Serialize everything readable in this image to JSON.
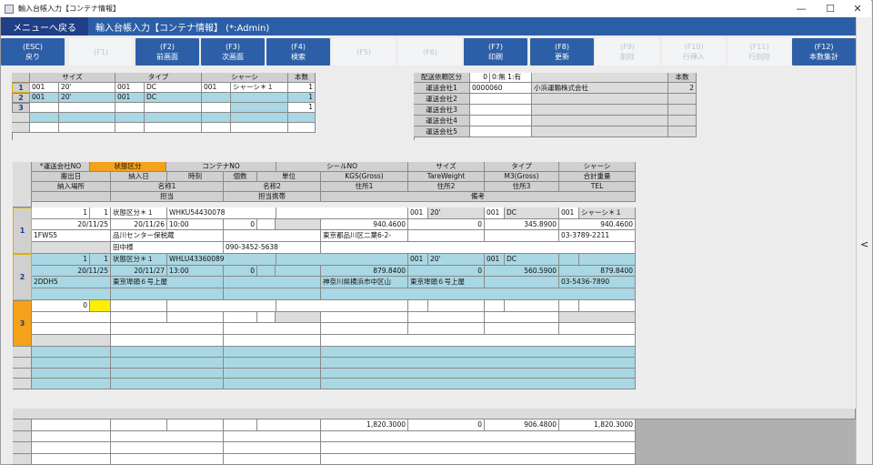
{
  "window": {
    "title": "輸入台帳入力【コンテナ情報】",
    "min": "—",
    "max": "☐",
    "close": "✕"
  },
  "header": {
    "back_label": "メニューへ戻る",
    "form_title": "輸入台帳入力【コンテナ情報】 (*:Admin)"
  },
  "fkeys": [
    {
      "key": "(ESC)",
      "label": "戻り",
      "enabled": true
    },
    {
      "key": "(F1)",
      "label": "",
      "enabled": false
    },
    {
      "key": "(F2)",
      "label": "前画面",
      "enabled": true
    },
    {
      "key": "(F3)",
      "label": "次画面",
      "enabled": true
    },
    {
      "key": "(F4)",
      "label": "検索",
      "enabled": true
    },
    {
      "key": "(F5)",
      "label": "",
      "enabled": false
    },
    {
      "key": "(F6)",
      "label": "",
      "enabled": false
    },
    {
      "key": "(F7)",
      "label": "印刷",
      "enabled": true
    },
    {
      "key": "(F8)",
      "label": "更新",
      "enabled": true
    },
    {
      "key": "(F9)",
      "label": "削除",
      "enabled": false
    },
    {
      "key": "(F10)",
      "label": "行挿入",
      "enabled": false
    },
    {
      "key": "(F11)",
      "label": "行削除",
      "enabled": false
    },
    {
      "key": "(F12)",
      "label": "本数集計",
      "enabled": true
    }
  ],
  "size_table": {
    "headers": [
      "サイズ",
      "タイプ",
      "シャーシ",
      "本数"
    ],
    "rows": [
      {
        "no": "1",
        "size_code": "001",
        "size": "20'",
        "type_code": "001",
        "type": "DC",
        "chassis_code": "001",
        "chassis": "シャーシ＊１",
        "count": "1"
      },
      {
        "no": "2",
        "size_code": "001",
        "size": "20'",
        "type_code": "001",
        "type": "DC",
        "chassis_code": "",
        "chassis": "",
        "count": "1"
      },
      {
        "no": "3",
        "size_code": "",
        "size": "",
        "type_code": "",
        "type": "",
        "chassis_code": "",
        "chassis": "",
        "count": "1"
      }
    ]
  },
  "delivery": {
    "request_label": "配送依頼区分",
    "request_value": "0",
    "request_options": "0:無 1:有",
    "count_header": "本数",
    "carriers": [
      {
        "label": "運送会社1",
        "code": "0000060",
        "name": "小浜運輸株式会社",
        "count": "2"
      },
      {
        "label": "運送会社2",
        "code": "",
        "name": "",
        "count": ""
      },
      {
        "label": "運送会社3",
        "code": "",
        "name": "",
        "count": ""
      },
      {
        "label": "運送会社4",
        "code": "",
        "name": "",
        "count": ""
      },
      {
        "label": "運送会社5",
        "code": "",
        "name": "",
        "count": ""
      }
    ]
  },
  "grid": {
    "h1": [
      "*運送会社NO",
      "状態区分",
      "コンテナNO",
      "シールNO",
      "サイズ",
      "タイプ",
      "シャーシ"
    ],
    "h2": [
      "搬出日",
      "納入日",
      "時刻",
      "個数",
      "単位",
      "KGS(Gross)",
      "TareWeight",
      "M3(Gross)",
      "合計重量"
    ],
    "h3": [
      "納入場所",
      "名称1",
      "名称2",
      "住所1",
      "住所2",
      "住所3",
      "TEL"
    ],
    "h4": [
      "担当",
      "担当携帯",
      "備考"
    ],
    "rows": [
      {
        "no": "1",
        "carrier": "1",
        "status_code": "1",
        "status": "状態区分＊１",
        "container": "WHKU54430078",
        "size_code": "001",
        "size": "20'",
        "type_code": "001",
        "type": "DC",
        "chassis_code": "001",
        "chassis": "シャーシ＊１",
        "out_date": "20/11/25",
        "in_date": "20/11/26",
        "time": "10:00",
        "qty": "0",
        "kgs": "940.4600",
        "tare": "0",
        "m3": "345.8900",
        "total": "940.4600",
        "place": "1FWS5",
        "name1": "品川センター保税蔵",
        "addr1": "東京都品川区二葉6-2-",
        "tel": "03-3789-2211",
        "person": "田中様",
        "mobile": "090-3452-5638"
      },
      {
        "no": "2",
        "carrier": "1",
        "status_code": "1",
        "status": "状態区分＊１",
        "container": "WHLU43360089",
        "size_code": "001",
        "size": "20'",
        "type_code": "001",
        "type": "DC",
        "out_date": "20/11/25",
        "in_date": "20/11/27",
        "time": "13:00",
        "qty": "0",
        "kgs": "879.8400",
        "tare": "0",
        "m3": "560.5900",
        "total": "879.8400",
        "place": "2DDH5",
        "name1": "東京埠頭６号上屋",
        "addr1": "神奈川県横浜市中区山",
        "addr2": "東京埠頭６号上屋",
        "tel": "03-5436-7890"
      },
      {
        "no": "3",
        "carrier": "0"
      }
    ]
  },
  "totals": {
    "kgs": "1,820.3000",
    "tare": "0",
    "m3": "906.4800",
    "total": "1,820.3000"
  },
  "collapse_icon": "<"
}
